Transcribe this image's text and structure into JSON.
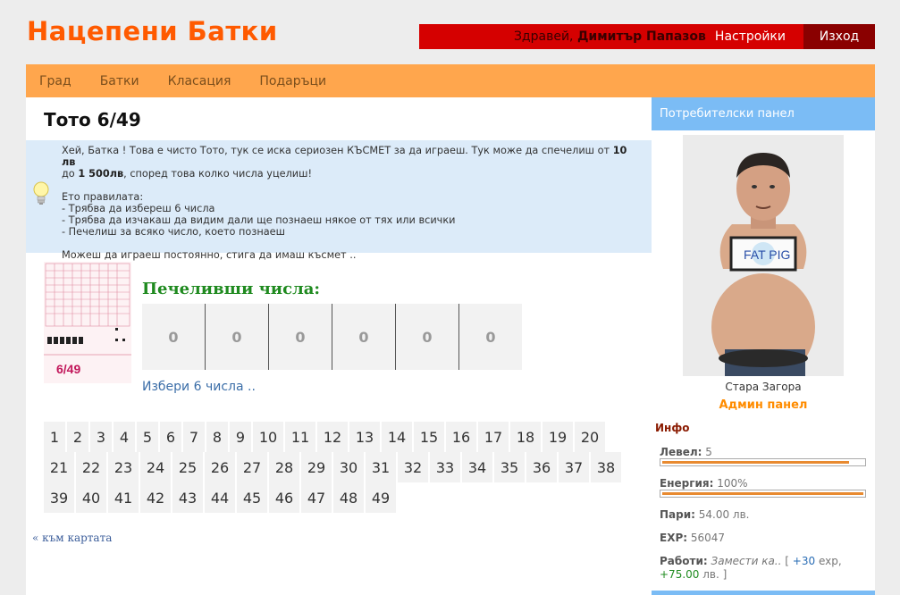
{
  "site": {
    "title": "Нацепени Батки"
  },
  "userbar": {
    "greeting": "Здравей,",
    "username": "Димитър Папазов",
    "settings": "Настройки",
    "logout": "Изход"
  },
  "nav": [
    "Град",
    "Батки",
    "Класация",
    "Подаръци"
  ],
  "page": {
    "title": "Тото 6/49",
    "intro_1a": "Хей, Батка ! Това е чисто Тото, тук се иска сериозен КЪСМЕТ за да играеш. Тук може да спечелиш от ",
    "intro_1b": "10 лв",
    "intro_1c": " до ",
    "intro_1d": "1 500лв",
    "intro_1e": ", според това колко числа уцелиш!",
    "rules_title": "Ето правилата:",
    "rule_1": "- Трябва да избереш 6 числа",
    "rule_2": "- Трябва да изчакаш да видим дали ще познаеш някое от тях или всички",
    "rule_3": "- Печелиш за всяко число, което познаеш",
    "outro": "Можеш да играеш постоянно, стига да имаш късмет ..",
    "winning_title": "Печеливши числа:",
    "winning": [
      "0",
      "0",
      "0",
      "0",
      "0",
      "0"
    ],
    "choose": "Избери 6 числа ..",
    "ticket_label": "6/49",
    "numbers_row1": [
      "1",
      "2",
      "3",
      "4",
      "5",
      "6",
      "7",
      "8",
      "9",
      "10",
      "11",
      "12",
      "13",
      "14",
      "15",
      "16",
      "17",
      "18",
      "19",
      "20"
    ],
    "numbers_row2": [
      "21",
      "22",
      "23",
      "24",
      "25",
      "26",
      "27",
      "28",
      "29",
      "30",
      "31",
      "32",
      "33",
      "34",
      "35",
      "36",
      "37",
      "38"
    ],
    "numbers_row3": [
      "39",
      "40",
      "41",
      "42",
      "43",
      "44",
      "45",
      "46",
      "47",
      "48",
      "49"
    ],
    "back": "« към картата"
  },
  "side": {
    "header": "Потребителски панел",
    "sign_text": "FAT PIG",
    "city": "Стара Загора",
    "admin": "Админ панел",
    "info": "Инфо",
    "level_label": "Левел:",
    "level_value": "5",
    "level_progress": 0.93,
    "energy_label": "Енергия:",
    "energy_value": "100%",
    "energy_progress": 1.0,
    "money_label": "Пари:",
    "money_value": "54.00 лв.",
    "exp_label": "EXP:",
    "exp_value": "56047",
    "work_label": "Работи:",
    "work_job": "Замести ка..",
    "work_open": "[",
    "work_exp": "+30",
    "work_exp_unit": "exp,",
    "work_money": "+75.00",
    "work_money_unit": "лв. ]"
  },
  "colors": {
    "brand": "#ff5a00",
    "userbar": "#d50000",
    "nav": "#ffa64d",
    "panel_head": "#7bbcf5",
    "info_box": "#dcebf9"
  }
}
